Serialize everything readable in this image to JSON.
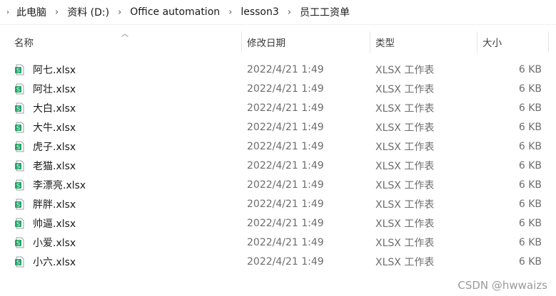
{
  "breadcrumb": [
    "此电脑",
    "资料 (D:)",
    "Office automation",
    "lesson3",
    "员工工资单"
  ],
  "columns": {
    "name": "名称",
    "modified": "修改日期",
    "type": "类型",
    "size": "大小"
  },
  "files": [
    {
      "name": "阿七.xlsx",
      "modified": "2022/4/21 1:49",
      "type": "XLSX 工作表",
      "size": "6 KB"
    },
    {
      "name": "阿壮.xlsx",
      "modified": "2022/4/21 1:49",
      "type": "XLSX 工作表",
      "size": "6 KB"
    },
    {
      "name": "大白.xlsx",
      "modified": "2022/4/21 1:49",
      "type": "XLSX 工作表",
      "size": "6 KB"
    },
    {
      "name": "大牛.xlsx",
      "modified": "2022/4/21 1:49",
      "type": "XLSX 工作表",
      "size": "6 KB"
    },
    {
      "name": "虎子.xlsx",
      "modified": "2022/4/21 1:49",
      "type": "XLSX 工作表",
      "size": "6 KB"
    },
    {
      "name": "老猫.xlsx",
      "modified": "2022/4/21 1:49",
      "type": "XLSX 工作表",
      "size": "6 KB"
    },
    {
      "name": "李漂亮.xlsx",
      "modified": "2022/4/21 1:49",
      "type": "XLSX 工作表",
      "size": "6 KB"
    },
    {
      "name": "胖胖.xlsx",
      "modified": "2022/4/21 1:49",
      "type": "XLSX 工作表",
      "size": "6 KB"
    },
    {
      "name": "帅逼.xlsx",
      "modified": "2022/4/21 1:49",
      "type": "XLSX 工作表",
      "size": "6 KB"
    },
    {
      "name": "小爱.xlsx",
      "modified": "2022/4/21 1:49",
      "type": "XLSX 工作表",
      "size": "6 KB"
    },
    {
      "name": "小六.xlsx",
      "modified": "2022/4/21 1:49",
      "type": "XLSX 工作表",
      "size": "6 KB"
    }
  ],
  "watermark": "CSDN @hwwaizs",
  "colors": {
    "excel_green": "#21a366",
    "excel_dark": "#107c41"
  }
}
